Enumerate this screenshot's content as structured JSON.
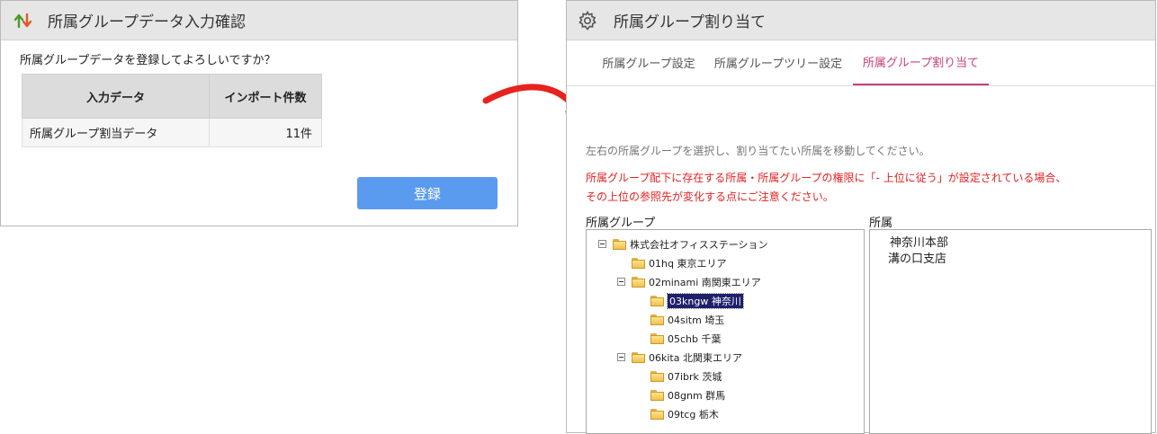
{
  "dialog": {
    "title": "所属グループデータ入力確認",
    "message": "所属グループデータを登録してよろしいですか？",
    "table": {
      "headers": [
        "入力データ",
        "インポート件数"
      ],
      "rows": [
        [
          "所属グループ割当データ",
          "11件"
        ]
      ]
    },
    "register_label": "登録"
  },
  "window": {
    "title": "所属グループ割り当て",
    "tabs": [
      {
        "label": "所属グループ設定"
      },
      {
        "label": "所属グループツリー設定"
      },
      {
        "label": "所属グループ割り当て"
      }
    ],
    "active_tab": "所属グループ割り当て",
    "info": "左右の所属グループを選択し、割り当てたい所属を移動してください。",
    "warning_lines": [
      "所属グループ配下に存在する所属・所属グループの権限に「- 上位に従う」が設定されている場合、",
      "その上位の参照先が変化する点にご注意ください。"
    ],
    "group_label": "所属グループ",
    "member_label": "所属",
    "tree": [
      {
        "label": "株式会社オフィスステーション"
      },
      {
        "label": "01hq 東京エリア"
      },
      {
        "label": "02minami 南関東エリア"
      },
      {
        "label": "03kngw 神奈川",
        "selected": true
      },
      {
        "label": "04sitm 埼玉"
      },
      {
        "label": "05chb 千葉"
      },
      {
        "label": "06kita 北関東エリア"
      },
      {
        "label": "07ibrk 茨城"
      },
      {
        "label": "08gnm 群馬"
      },
      {
        "label": "09tcg 栃木"
      }
    ],
    "members": [
      "神奈川本部",
      "溝の口支店"
    ]
  },
  "colors": {
    "accent": "#c8417a",
    "button": "#5b9bef",
    "warning": "#e32222",
    "arrow": "#e8221e"
  }
}
